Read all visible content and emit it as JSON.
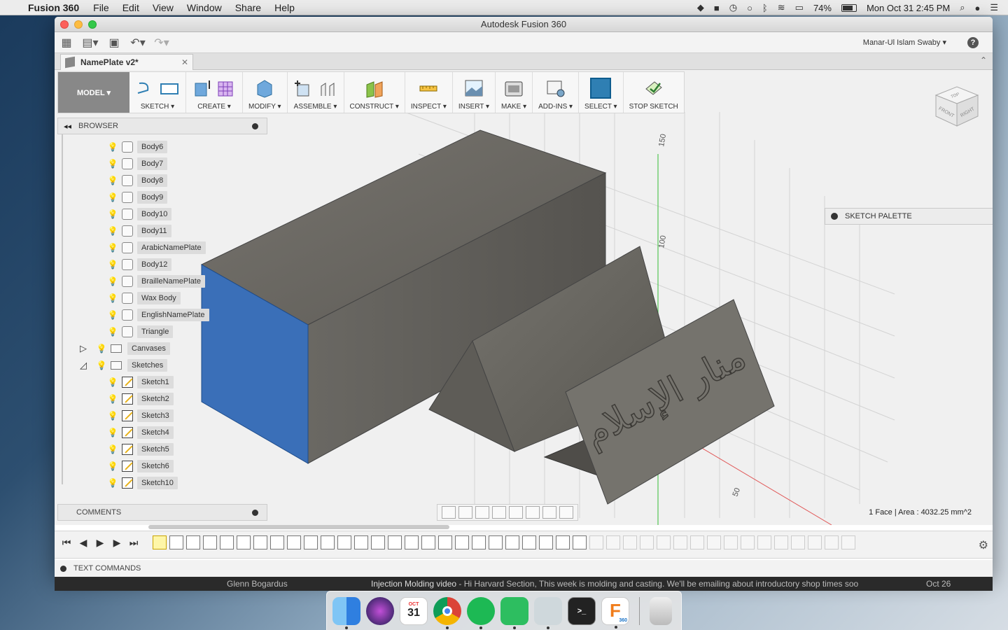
{
  "menubar": {
    "app_name": "Fusion 360",
    "items": [
      "File",
      "Edit",
      "View",
      "Window",
      "Share",
      "Help"
    ],
    "battery": "74%",
    "clock": "Mon Oct 31  2:45 PM"
  },
  "window": {
    "title": "Autodesk Fusion 360",
    "user": "Manar-Ul Islam Swaby ▾",
    "doc_tab": "NamePlate v2*"
  },
  "toolbar": {
    "workspace": "MODEL ▾",
    "groups": [
      {
        "label": "SKETCH ▾"
      },
      {
        "label": "CREATE ▾"
      },
      {
        "label": "MODIFY ▾"
      },
      {
        "label": "ASSEMBLE ▾"
      },
      {
        "label": "CONSTRUCT ▾"
      },
      {
        "label": "INSPECT ▾"
      },
      {
        "label": "INSERT ▾"
      },
      {
        "label": "MAKE ▾"
      },
      {
        "label": "ADD-INS ▾"
      },
      {
        "label": "SELECT ▾"
      },
      {
        "label": "STOP SKETCH"
      }
    ]
  },
  "browser": {
    "title": "BROWSER",
    "bodies": [
      {
        "name": "Body6",
        "visible": false
      },
      {
        "name": "Body7",
        "visible": false
      },
      {
        "name": "Body8",
        "visible": false
      },
      {
        "name": "Body9",
        "visible": false
      },
      {
        "name": "Body10",
        "visible": false
      },
      {
        "name": "Body11",
        "visible": false
      },
      {
        "name": "ArabicNamePlate",
        "visible": true
      },
      {
        "name": "Body12",
        "visible": true
      },
      {
        "name": "BrailleNamePlate",
        "visible": true
      },
      {
        "name": "Wax Body",
        "visible": true
      },
      {
        "name": "EnglishNamePlate",
        "visible": true
      },
      {
        "name": "Triangle",
        "visible": true
      }
    ],
    "folders": [
      {
        "name": "Canvases",
        "expanded": false
      },
      {
        "name": "Sketches",
        "expanded": true
      }
    ],
    "sketches": [
      "Sketch1",
      "Sketch2",
      "Sketch3",
      "Sketch4",
      "Sketch5",
      "Sketch6",
      "Sketch10"
    ]
  },
  "panels": {
    "comments": "COMMENTS",
    "sketch_palette": "SKETCH PALETTE",
    "text_commands": "TEXT COMMANDS"
  },
  "viewcube": {
    "top": "TOP",
    "front": "FRONT",
    "right": "RIGHT"
  },
  "grid_labels": {
    "l150": "150",
    "l100": "100",
    "l50": "50"
  },
  "status": "1 Face | Area : 4032.25 mm^2",
  "arabic_text": "منار الإسلام",
  "mail": {
    "from": "Glenn Bogardus",
    "subject": "Injection Molding video",
    "preview": " - Hi Harvard Section, This week is molding and casting. We'll be emailing about introductory shop times soo",
    "date": "Oct 26"
  },
  "colors": {
    "accent_blue": "#2f7fb3",
    "face_blue": "#3a6fb8",
    "model_grey": "#6e6c66",
    "bulb_on": "#e4c21e"
  },
  "dock": {
    "apps": [
      "finder-icon",
      "siri-icon",
      "calendar-icon",
      "chrome-icon",
      "spotify-icon",
      "evernote-icon",
      "preview-icon",
      "terminal-icon",
      "fusion360-icon",
      "trash-icon"
    ],
    "calendar_month": "OCT",
    "calendar_day": "31",
    "fusion_badge": "360"
  }
}
